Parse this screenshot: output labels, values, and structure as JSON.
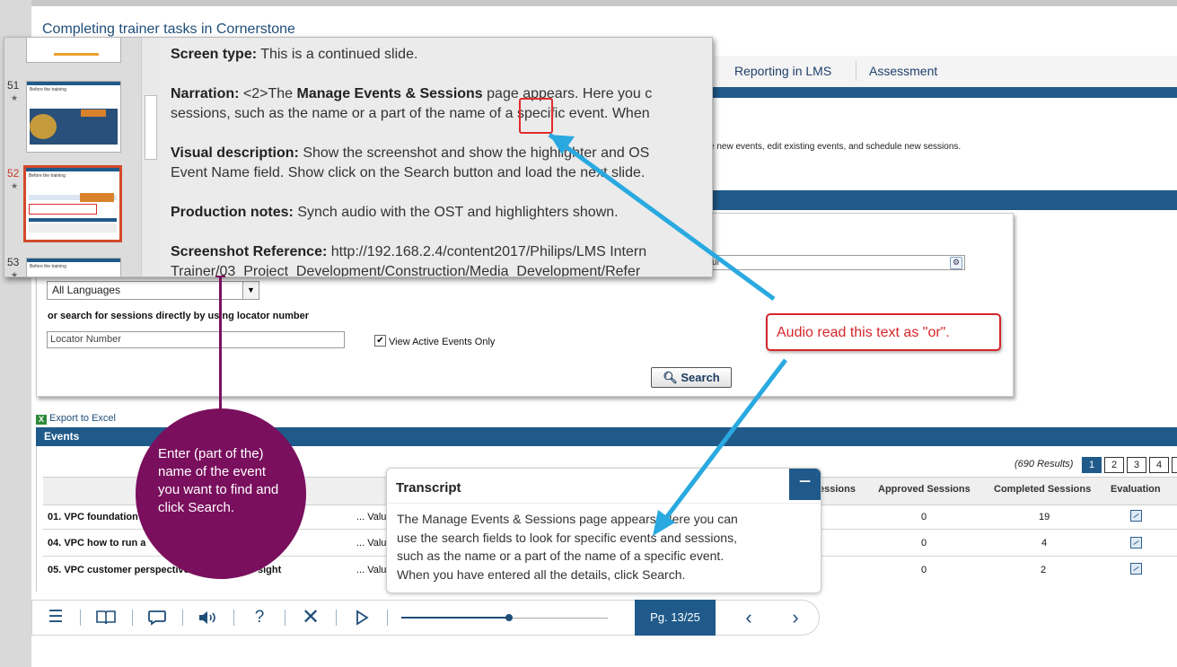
{
  "course": {
    "title": "Completing trainer tasks in Cornerstone"
  },
  "nav_tabs": [
    {
      "label": "Reporting in LMS"
    },
    {
      "label": "Assessment"
    }
  ],
  "lms": {
    "description": "e new events, edit existing events, and schedule new sessions.",
    "search_hint_value": "nour",
    "language_select": "All Languages",
    "locator_label": "or search for sessions directly by using locator number",
    "locator_placeholder": "Locator Number",
    "active_only_label": "View Active Events Only",
    "search_button": "Search",
    "export_label": "Export to Excel",
    "events_title": "Events",
    "results_text": "(690 Results)",
    "pages": [
      "1",
      "2",
      "3",
      "4"
    ],
    "columns": [
      "essions",
      "Approved Sessions",
      "Completed Sessions",
      "Evaluation"
    ],
    "rows": [
      {
        "name": "01. VPC foundation",
        "value": "... Valu",
        "approved": "0",
        "completed": "19"
      },
      {
        "name": "04. VPC how to run a",
        "value": "... Valu",
        "approved": "0",
        "completed": "4"
      },
      {
        "name": "05. VPC customer perspective",
        "name_tail": "sight",
        "value": "... Valu",
        "approved": "0",
        "completed": "2"
      }
    ]
  },
  "notes_popup": {
    "slides": [
      {
        "num": "51",
        "thumb_text": "Before the training"
      },
      {
        "num": "52",
        "thumb_text": "Before the training"
      },
      {
        "num": "53",
        "thumb_text": "Before the training"
      }
    ],
    "screen_type_label": "Screen type:",
    "screen_type_value": "This is a continued slide.",
    "narration_label": "Narration:",
    "narration_pre": "<2>The",
    "narration_bold": "Manage Events & Sessions",
    "narration_post": "page appears. Here you c",
    "narration_line2": "sessions, such as the name or a part of the name of a specific event. When",
    "visual_label": "Visual description:",
    "visual_line1": "Show the screenshot and show the highlighter and OS",
    "visual_line2": "Event Name field. Show click on the Search button and load the next slide.",
    "production_label": "Production notes:",
    "production_value": "Synch audio with the OST and highlighters shown.",
    "reference_label": "Screenshot Reference:",
    "reference_line1": "http://192.168.2.4/content2017/Philips/LMS Intern",
    "reference_line2": "Trainer/03_Project_Development/Construction/Media_Development/Refer"
  },
  "trainer_note": {
    "text": "Enter (part of the) name of the event you want to find and click Search."
  },
  "review_callout": {
    "text": "Audio read this text as \"or\"."
  },
  "transcript": {
    "title": "Transcript",
    "minimize_icon": "minus-icon",
    "lines": [
      "The Manage Events & Sessions page appears. Here you can",
      "use the search fields to look for specific events and sessions,",
      "such as the name or a part of the name of a specific event.",
      "When you have entered all the details, click Search."
    ]
  },
  "player": {
    "page_label": "Pg. 13/25",
    "progress": 0.52,
    "icons": [
      "menu-icon",
      "book-icon",
      "comment-icon",
      "volume-icon",
      "help-icon",
      "close-icon",
      "play-icon",
      "chevron-left-icon",
      "chevron-right-icon"
    ]
  },
  "colors": {
    "brand_blue": "#1f5a8a",
    "callout_red": "#d6262b",
    "note_purple": "#7a0f5e",
    "arrow_blue": "#29a9e0"
  }
}
